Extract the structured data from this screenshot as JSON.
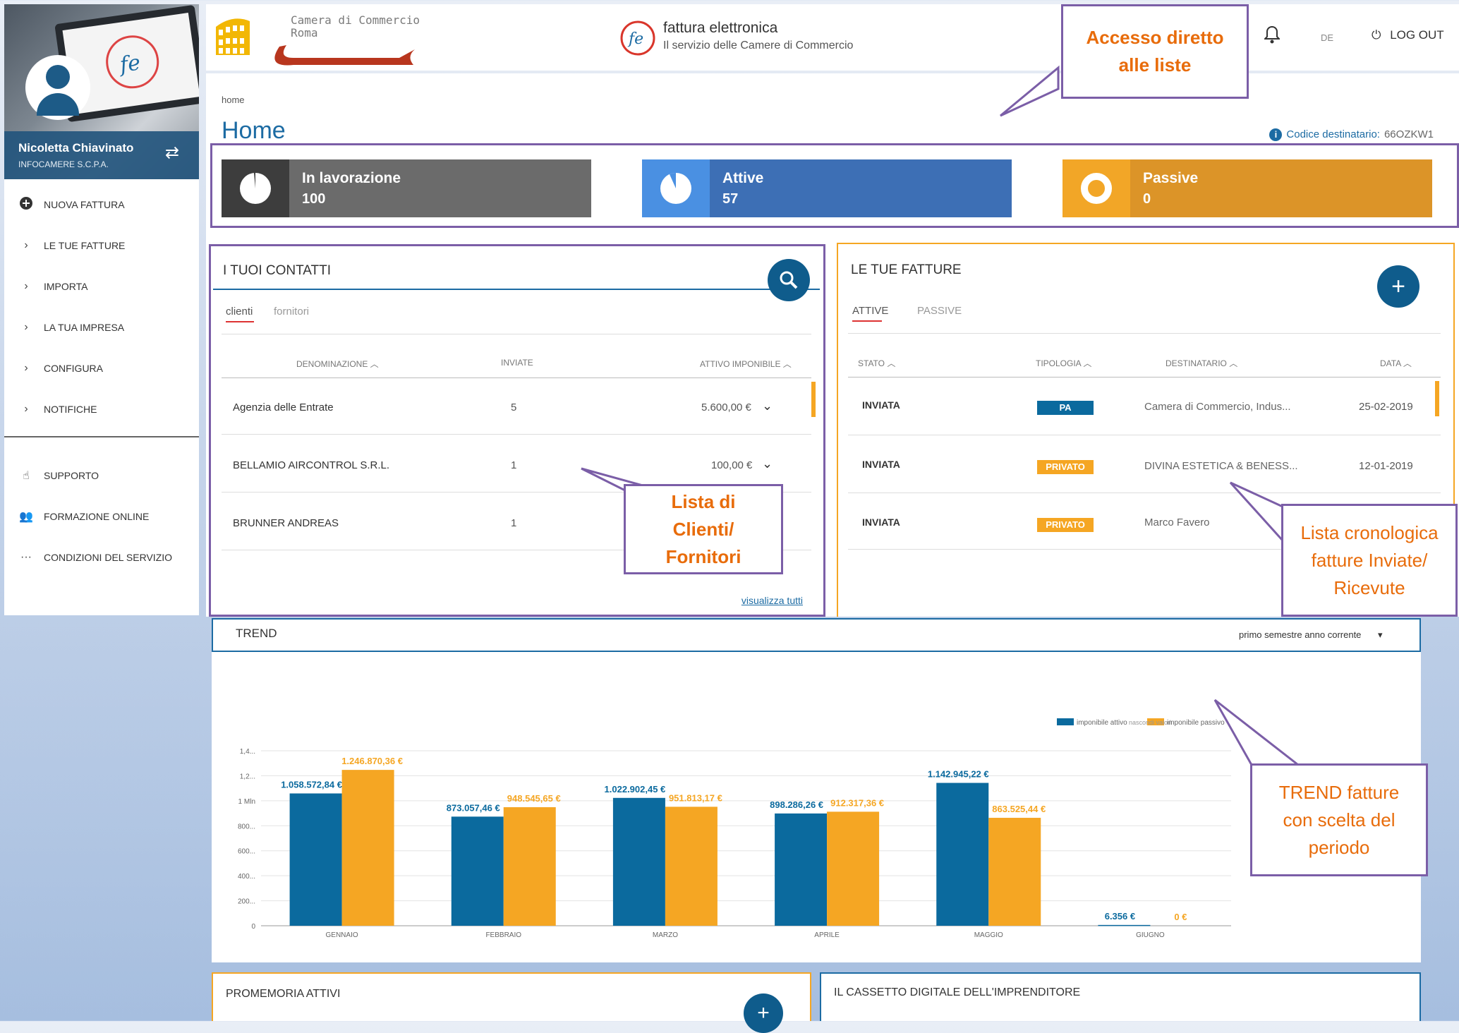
{
  "header": {
    "cc_logo_text_1": "Camera di Commercio",
    "cc_logo_text_2": "Roma",
    "fe_title": "fattura elettronica",
    "fe_subtitle": "Il servizio delle Camere di Commercio",
    "lang": "DE",
    "logout": "LOG OUT"
  },
  "user": {
    "name": "Nicoletta Chiavinato",
    "company": "INFOCAMERE S.C.P.A."
  },
  "sidebar": {
    "items": [
      {
        "label": "NUOVA FATTURA",
        "icon": "plus-circle-icon"
      },
      {
        "label": "LE TUE FATTURE",
        "icon": "chevron-right-icon"
      },
      {
        "label": "IMPORTA",
        "icon": "chevron-right-icon"
      },
      {
        "label": "LA TUA IMPRESA",
        "icon": "chevron-right-icon"
      },
      {
        "label": "CONFIGURA",
        "icon": "chevron-right-icon"
      },
      {
        "label": "NOTIFICHE",
        "icon": "chevron-right-icon"
      }
    ],
    "secondary": [
      {
        "label": "SUPPORTO",
        "icon": "hand-icon"
      },
      {
        "label": "FORMAZIONE ONLINE",
        "icon": "users-icon"
      },
      {
        "label": "CONDIZIONI DEL SERVIZIO",
        "icon": "ellipsis-icon"
      }
    ]
  },
  "page": {
    "breadcrumb": "home",
    "title": "Home",
    "codice_label": "Codice destinatario:",
    "codice_value": "66OZKW1"
  },
  "stats": [
    {
      "label": "In lavorazione",
      "value": "100",
      "color": "#6b6b6b",
      "icon_color": "#3d3d3d",
      "fill": 1.0
    },
    {
      "label": "Attive",
      "value": "57",
      "color": "#3d6fb5",
      "icon_color": "#4a90e2",
      "fill": 0.9
    },
    {
      "label": "Passive",
      "value": "0",
      "color": "#dc9428",
      "icon_color": "#f2a627",
      "fill": 0.0
    }
  ],
  "contatti": {
    "title": "I TUOI CONTATTI",
    "tabs": [
      "clienti",
      "fornitori"
    ],
    "columns": [
      "DENOMINAZIONE",
      "INVIATE",
      "ATTIVO IMPONIBILE"
    ],
    "rows": [
      {
        "name": "Agenzia delle Entrate",
        "inviate": "5",
        "imponibile": "5.600,00 €"
      },
      {
        "name": "BELLAMIO AIRCONTROL S.R.L.",
        "inviate": "1",
        "imponibile": "100,00 €"
      },
      {
        "name": "BRUNNER ANDREAS",
        "inviate": "1",
        "imponibile": ""
      }
    ],
    "link": "visualizza tutti"
  },
  "fatture": {
    "title": "LE TUE FATTURE",
    "tabs": [
      "ATTIVE",
      "PASSIVE"
    ],
    "columns": [
      "STATO",
      "TIPOLOGIA",
      "DESTINATARIO",
      "DATA"
    ],
    "rows": [
      {
        "stato": "INVIATA",
        "tipologia": "PA",
        "destinatario": "Camera di Commercio, Indus...",
        "data": "25-02-2019"
      },
      {
        "stato": "INVIATA",
        "tipologia": "PRIVATO",
        "destinatario": "DIVINA ESTETICA & BENESS...",
        "data": "12-01-2019"
      },
      {
        "stato": "INVIATA",
        "tipologia": "PRIVATO",
        "destinatario": "Marco  Favero",
        "data": ""
      }
    ]
  },
  "trend": {
    "title": "TREND",
    "period": "primo semestre anno corrente"
  },
  "chart_data": {
    "type": "bar",
    "categories": [
      "GENNAIO",
      "FEBBRAIO",
      "MARZO",
      "APRILE",
      "MAGGIO",
      "GIUGNO"
    ],
    "series": [
      {
        "name": "imponibile attivo",
        "color": "#0b6a9e",
        "values": [
          1058572.84,
          873057.46,
          1022902.45,
          898286.26,
          1142945.22,
          6356
        ],
        "labels": [
          "1.058.572,84 €",
          "873.057,46 €",
          "1.022.902,45 €",
          "898.286,26 €",
          "1.142.945,22 €",
          "6.356 €"
        ]
      },
      {
        "name": "imponibile passivo",
        "color": "#f5a623",
        "values": [
          1246870.36,
          948545.65,
          951813.17,
          912317.36,
          863525.44,
          0
        ],
        "labels": [
          "1.246.870,36 €",
          "948.545,65 €",
          "951.813,17 €",
          "912.317,36 €",
          "863.525,44 €",
          "0 €"
        ]
      }
    ],
    "ylim": [
      0,
      1400000
    ],
    "yticks": [
      {
        "v": 0,
        "t": "0"
      },
      {
        "v": 200000,
        "t": "200..."
      },
      {
        "v": 400000,
        "t": "400..."
      },
      {
        "v": 600000,
        "t": "600..."
      },
      {
        "v": 800000,
        "t": "800..."
      },
      {
        "v": 1000000,
        "t": "1 Mln"
      },
      {
        "v": 1200000,
        "t": "1,2..."
      },
      {
        "v": 1400000,
        "t": "1,4..."
      }
    ],
    "legend_toggle": "nascondi valori",
    "legend_position": "top-right",
    "grid": true
  },
  "bottom": {
    "promemoria": "PROMEMORIA ATTIVI",
    "cassetto": "IL CASSETTO DIGITALE DELL'IMPRENDITORE"
  },
  "annotations": {
    "accesso": [
      "Accesso diretto",
      "alle liste"
    ],
    "lista_clienti": [
      "Lista di",
      "Clienti/",
      "Fornitori"
    ],
    "lista_cronologica": [
      "Lista cronologica",
      "fatture  Inviate/",
      "Ricevute"
    ],
    "trend": [
      "TREND fatture",
      "con scelta del",
      "periodo"
    ],
    "color": "#e86c0b",
    "frame_color": "#7b5ea7"
  }
}
